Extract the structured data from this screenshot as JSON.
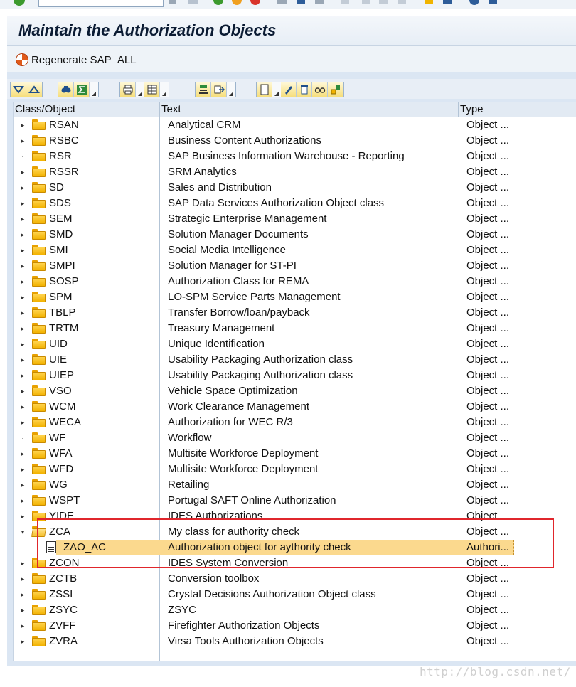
{
  "title": "Maintain the Authorization Objects",
  "app_toolbar": {
    "regenerate_label": "Regenerate SAP_ALL"
  },
  "alv_toolbar": {
    "buttons": [
      "expand-all-icon",
      "collapse-all-icon",
      "find-icon",
      "sum-icon",
      "print-icon",
      "layout-icon",
      "ok-icon",
      "export-icon",
      "new-document-icon",
      "pencil-icon",
      "trash-icon",
      "glasses-icon",
      "tree-icon"
    ]
  },
  "grid": {
    "columns": [
      "Class/Object",
      "Text",
      "Type"
    ],
    "rows": [
      {
        "level": 0,
        "expander": "▸",
        "node": "folder",
        "name": "RSAN",
        "text": "Analytical CRM",
        "type": "Object ..."
      },
      {
        "level": 0,
        "expander": "▸",
        "node": "folder",
        "name": "RSBC",
        "text": "Business Content Authorizations",
        "type": "Object ..."
      },
      {
        "level": 0,
        "expander": "·",
        "node": "folder",
        "name": "RSR",
        "text": "SAP Business Information Warehouse - Reporting",
        "type": "Object ..."
      },
      {
        "level": 0,
        "expander": "▸",
        "node": "folder",
        "name": "RSSR",
        "text": "SRM Analytics",
        "type": "Object ..."
      },
      {
        "level": 0,
        "expander": "▸",
        "node": "folder",
        "name": "SD",
        "text": "Sales and Distribution",
        "type": "Object ..."
      },
      {
        "level": 0,
        "expander": "▸",
        "node": "folder",
        "name": "SDS",
        "text": "SAP Data Services Authorization Object class",
        "type": "Object ..."
      },
      {
        "level": 0,
        "expander": "▸",
        "node": "folder",
        "name": "SEM",
        "text": "Strategic Enterprise Management",
        "type": "Object ..."
      },
      {
        "level": 0,
        "expander": "▸",
        "node": "folder",
        "name": "SMD",
        "text": "Solution Manager Documents",
        "type": "Object ..."
      },
      {
        "level": 0,
        "expander": "▸",
        "node": "folder",
        "name": "SMI",
        "text": "Social Media Intelligence",
        "type": "Object ..."
      },
      {
        "level": 0,
        "expander": "▸",
        "node": "folder",
        "name": "SMPI",
        "text": "Solution Manager for ST-PI",
        "type": "Object ..."
      },
      {
        "level": 0,
        "expander": "▸",
        "node": "folder",
        "name": "SOSP",
        "text": "Authorization Class for REMA",
        "type": "Object ..."
      },
      {
        "level": 0,
        "expander": "▸",
        "node": "folder",
        "name": "SPM",
        "text": "LO-SPM Service Parts Management",
        "type": "Object ..."
      },
      {
        "level": 0,
        "expander": "▸",
        "node": "folder",
        "name": "TBLP",
        "text": "Transfer Borrow/loan/payback",
        "type": "Object ..."
      },
      {
        "level": 0,
        "expander": "▸",
        "node": "folder",
        "name": "TRTM",
        "text": "Treasury Management",
        "type": "Object ..."
      },
      {
        "level": 0,
        "expander": "▸",
        "node": "folder",
        "name": "UID",
        "text": "Unique Identification",
        "type": "Object ..."
      },
      {
        "level": 0,
        "expander": "▸",
        "node": "folder",
        "name": "UIE",
        "text": "Usability Packaging Authorization class",
        "type": "Object ..."
      },
      {
        "level": 0,
        "expander": "▸",
        "node": "folder",
        "name": "UIEP",
        "text": "Usability Packaging Authorization class",
        "type": "Object ..."
      },
      {
        "level": 0,
        "expander": "▸",
        "node": "folder",
        "name": "VSO",
        "text": "Vehicle Space Optimization",
        "type": "Object ..."
      },
      {
        "level": 0,
        "expander": "▸",
        "node": "folder",
        "name": "WCM",
        "text": "Work Clearance Management",
        "type": "Object ..."
      },
      {
        "level": 0,
        "expander": "▸",
        "node": "folder",
        "name": "WECA",
        "text": "Authorization for WEC R/3",
        "type": "Object ..."
      },
      {
        "level": 0,
        "expander": "·",
        "node": "folder",
        "name": "WF",
        "text": "Workflow",
        "type": "Object ..."
      },
      {
        "level": 0,
        "expander": "▸",
        "node": "folder",
        "name": "WFA",
        "text": "Multisite Workforce Deployment",
        "type": "Object ..."
      },
      {
        "level": 0,
        "expander": "▸",
        "node": "folder",
        "name": "WFD",
        "text": "Multisite Workforce Deployment",
        "type": "Object ..."
      },
      {
        "level": 0,
        "expander": "▸",
        "node": "folder",
        "name": "WG",
        "text": "Retailing",
        "type": "Object ..."
      },
      {
        "level": 0,
        "expander": "▸",
        "node": "folder",
        "name": "WSPT",
        "text": "Portugal SAFT Online Authorization",
        "type": "Object ..."
      },
      {
        "level": 0,
        "expander": "▸",
        "node": "folder",
        "name": "YIDE",
        "text": "IDES Authorizations",
        "type": "Object ..."
      },
      {
        "level": 0,
        "expander": "▾",
        "node": "folder-open",
        "name": "ZCA",
        "text": "My class for authority check",
        "type": "Object ..."
      },
      {
        "level": 1,
        "expander": "·",
        "node": "document",
        "name": "ZAO_AC",
        "text": "Authorization object for aythority check",
        "type": "Authori...",
        "selected": true
      },
      {
        "level": 0,
        "expander": "▸",
        "node": "folder",
        "name": "ZCON",
        "text": "IDES System Conversion",
        "type": "Object ..."
      },
      {
        "level": 0,
        "expander": "▸",
        "node": "folder",
        "name": "ZCTB",
        "text": "Conversion toolbox",
        "type": "Object ..."
      },
      {
        "level": 0,
        "expander": "▸",
        "node": "folder",
        "name": "ZSSI",
        "text": "Crystal Decisions Authorization Object class",
        "type": "Object ..."
      },
      {
        "level": 0,
        "expander": "▸",
        "node": "folder",
        "name": "ZSYC",
        "text": "ZSYC",
        "type": "Object ..."
      },
      {
        "level": 0,
        "expander": "▸",
        "node": "folder",
        "name": "ZVFF",
        "text": "Firefighter Authorization Objects",
        "type": "Object ..."
      },
      {
        "level": 0,
        "expander": "▸",
        "node": "folder",
        "name": "ZVRA",
        "text": "Virsa Tools Authorization Objects",
        "type": "Object ..."
      }
    ]
  },
  "watermark": "http://blog.csdn.net/",
  "colors": {
    "selection": "#fbd98e",
    "annotation_box": "#e0262c",
    "folder": "#f2b200"
  }
}
